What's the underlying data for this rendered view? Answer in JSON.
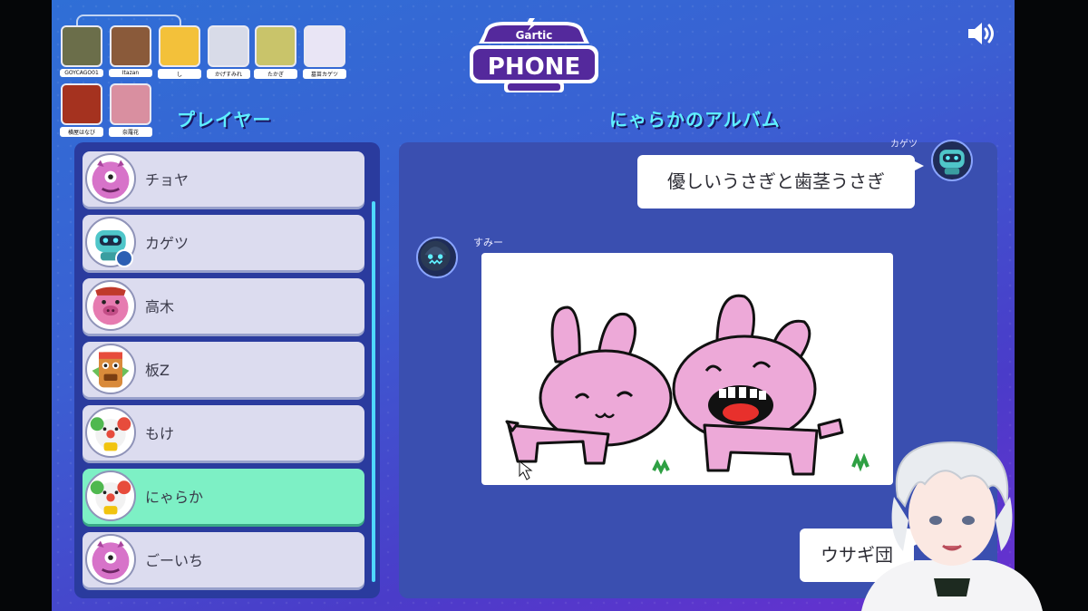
{
  "app": {
    "logo_top": "Gartic",
    "logo_bottom": "PHONE"
  },
  "top_avatars": [
    {
      "name": "GOYCAGO01",
      "color": "#6b6e4a"
    },
    {
      "name": "Itazan",
      "color": "#8a5a3a"
    },
    {
      "name": "し",
      "color": "#f3c13a"
    },
    {
      "name": "かげすみれ",
      "color": "#d8dbe8"
    },
    {
      "name": "たかぎ",
      "color": "#c9c46a"
    },
    {
      "name": "墓苗カゲツ",
      "color": "#e9e5f5"
    },
    {
      "name": "横屋はなび",
      "color": "#a5321f"
    },
    {
      "name": "奈羅花",
      "color": "#d98fa0"
    }
  ],
  "players_title": "プレイヤー",
  "album_title": "にゃらかのアルバム",
  "players": [
    {
      "name": "チョヤ",
      "avatar": "pink-monster",
      "active": false
    },
    {
      "name": "カゲツ",
      "avatar": "robot",
      "active": false,
      "badge": true
    },
    {
      "name": "高木",
      "avatar": "pig",
      "active": false
    },
    {
      "name": "板Z",
      "avatar": "tiki",
      "active": false
    },
    {
      "name": "もけ",
      "avatar": "clown",
      "active": false
    },
    {
      "name": "にゃらか",
      "avatar": "clown",
      "active": true
    },
    {
      "name": "ごーいち",
      "avatar": "pink-monster",
      "active": false
    }
  ],
  "album": {
    "top_author": "カゲツ",
    "prompt_text": "優しいうさぎと歯茎うさぎ",
    "drawing_author": "すみー",
    "answer_text": "ウサギ団"
  },
  "colors": {
    "accent_title": "#5ff0ff",
    "active_row": "#7df0c5"
  }
}
